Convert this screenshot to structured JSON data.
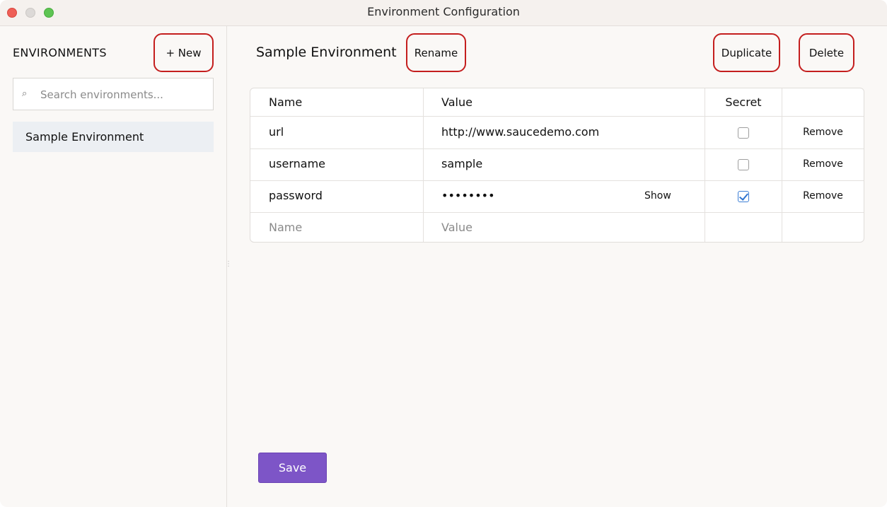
{
  "window": {
    "title": "Environment Configuration"
  },
  "sidebar": {
    "heading": "ENVIRONMENTS",
    "new_label": "+ New",
    "search_placeholder": "Search environments...",
    "items": [
      {
        "label": "Sample Environment",
        "selected": true
      }
    ]
  },
  "main": {
    "environment_name": "Sample Environment",
    "rename_label": "Rename",
    "duplicate_label": "Duplicate",
    "delete_label": "Delete",
    "save_label": "Save"
  },
  "table": {
    "headers": {
      "name": "Name",
      "value": "Value",
      "secret": "Secret"
    },
    "rows": [
      {
        "name": "url",
        "value": "http://www.saucedemo.com",
        "secret": false,
        "remove_label": "Remove"
      },
      {
        "name": "username",
        "value": "sample",
        "secret": false,
        "remove_label": "Remove"
      },
      {
        "name": "password",
        "value": "••••••••",
        "secret": true,
        "show_label": "Show",
        "remove_label": "Remove"
      }
    ],
    "new_row": {
      "name_placeholder": "Name",
      "value_placeholder": "Value"
    }
  },
  "colors": {
    "save_button": "#7d55c7",
    "highlight_border": "#c41e1e",
    "selected_item_bg": "#eceff3"
  }
}
